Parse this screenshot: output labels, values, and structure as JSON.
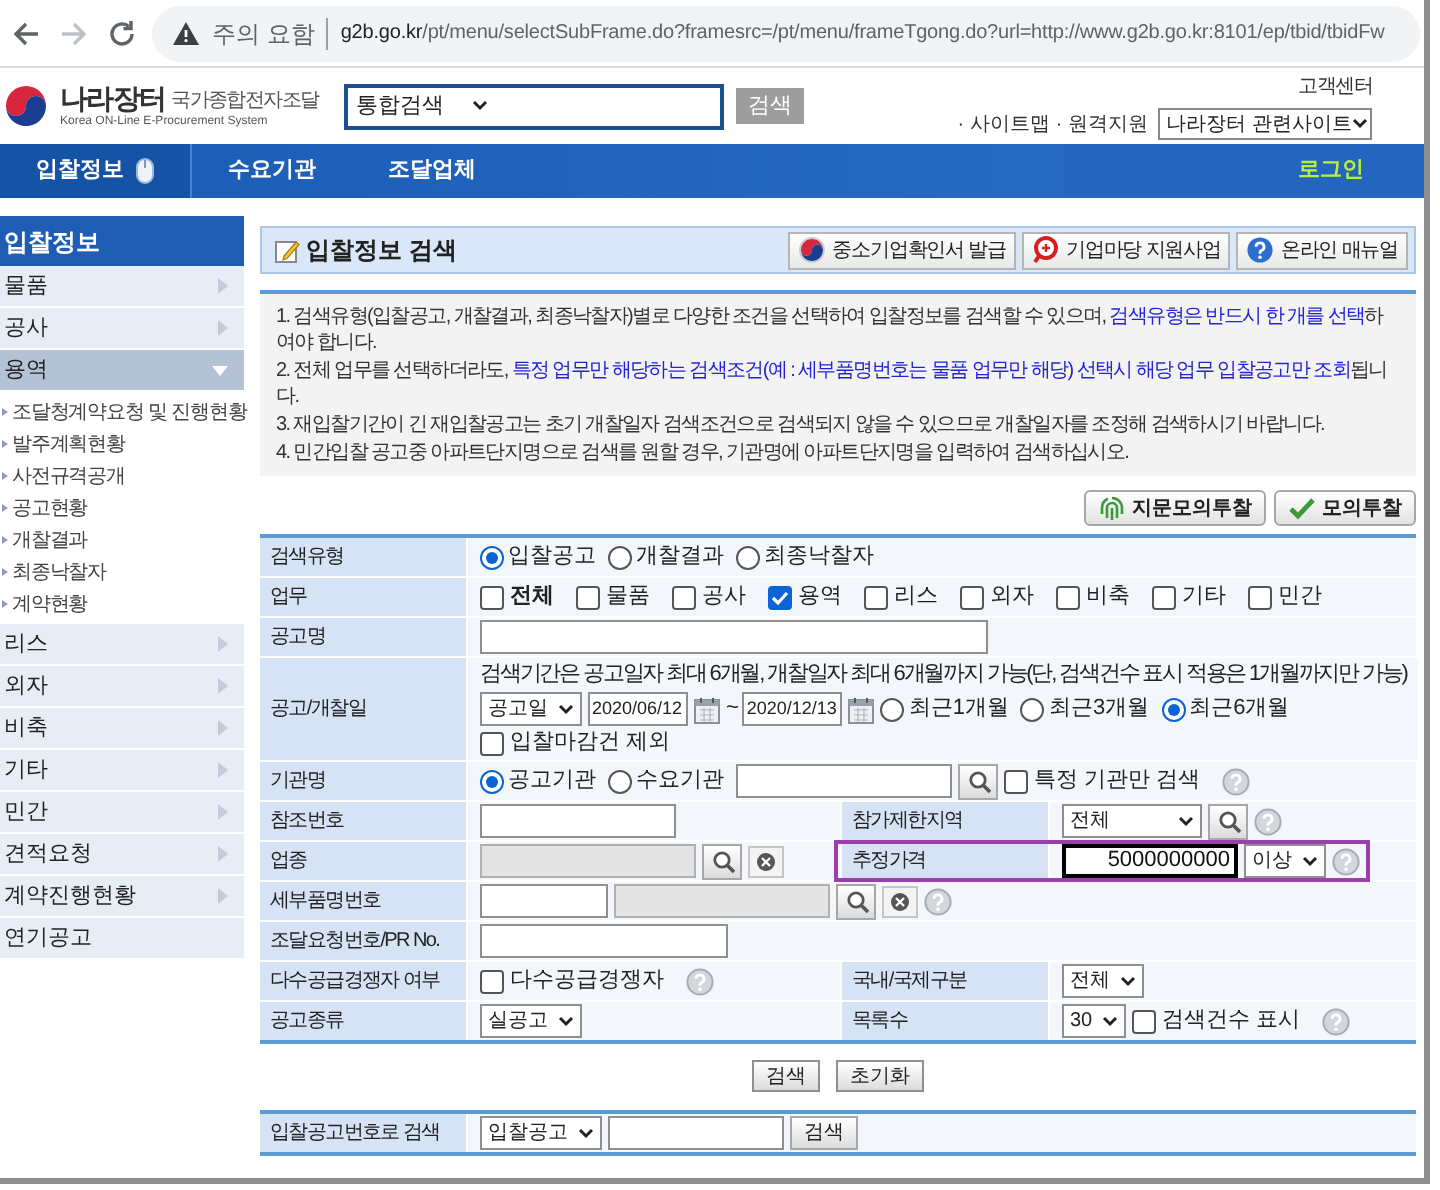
{
  "browser": {
    "warning": "주의 요함",
    "url_host": "g2b.go.kr",
    "url_path": "/pt/menu/selectSubFrame.do?framesrc=/pt/menu/frameTgong.do?url=http://www.g2b.go.kr:8101/ep/tbid/tbidFw"
  },
  "header": {
    "logo_title": "나라장터",
    "logo_subtitle": "국가종합전자조달",
    "logo_english": "Korea ON-Line E-Procurement System",
    "search_scope": "통합검색",
    "search_button": "검색",
    "customer_center": "고객센터",
    "links": [
      "· 사이트맵",
      "· 원격지원"
    ],
    "related_sites": "나라장터 관련사이트"
  },
  "nav": {
    "items": [
      {
        "label": "입찰정보",
        "selected": true
      },
      {
        "label": "수요기관",
        "selected": false
      },
      {
        "label": "조달업체",
        "selected": false
      }
    ],
    "login": "로그인"
  },
  "sidebar": {
    "title": "입찰정보",
    "items": [
      {
        "label": "물품",
        "kind": "group",
        "expanded": false
      },
      {
        "label": "공사",
        "kind": "group",
        "expanded": false
      },
      {
        "label": "용역",
        "kind": "group",
        "expanded": true,
        "children": [
          {
            "label": "조달청계약요청 및 진행현황"
          },
          {
            "label": "발주계획현황"
          },
          {
            "label": "사전규격공개"
          },
          {
            "label": "공고현황"
          },
          {
            "label": "개찰결과"
          },
          {
            "label": "최종낙찰자"
          },
          {
            "label": "계약현황"
          }
        ]
      },
      {
        "label": "리스",
        "kind": "group",
        "expanded": false
      },
      {
        "label": "외자",
        "kind": "group",
        "expanded": false
      },
      {
        "label": "비축",
        "kind": "group",
        "expanded": false
      },
      {
        "label": "기타",
        "kind": "group",
        "expanded": false
      },
      {
        "label": "민간",
        "kind": "group",
        "expanded": false
      },
      {
        "label": "견적요청",
        "kind": "group",
        "expanded": false
      },
      {
        "label": "계약진행현황",
        "kind": "group",
        "expanded": false
      },
      {
        "label": "연기공고",
        "kind": "link",
        "expanded": false
      }
    ]
  },
  "page": {
    "title": "입찰정보 검색",
    "buttons": [
      "중소기업확인서 발급",
      "기업마당 지원사업",
      "온라인 매뉴얼"
    ]
  },
  "notices": [
    [
      {
        "text": "1. 검색유형(입찰공고, 개찰결과, 최종낙찰자)별로 다양한 조건을 선택하여 입찰정보를 검색할 수 있으며, ",
        "highlight": false
      },
      {
        "text": "검색유형은 반드시 한 개를 선택",
        "highlight": true
      },
      {
        "text": "하여야 합니다.",
        "highlight": false
      }
    ],
    [
      {
        "text": "2. 전체 업무를 선택하더라도, ",
        "highlight": false
      },
      {
        "text": "특정 업무만 해당하는 검색조건(예 : 세부품명번호는 물품 업무만 해당) 선택시 해당 업무 입찰공고만 조회",
        "highlight": true
      },
      {
        "text": "됩니다.",
        "highlight": false
      }
    ],
    [
      {
        "text": "3. 재입찰기간이 긴 재입찰공고는 초기 개찰일자 검색조건으로 검색되지 않을 수 있으므로 개찰일자를 조정해 검색하시기 바랍니다.",
        "highlight": false
      }
    ],
    [
      {
        "text": "4. 민간입찰 공고중 아파트단지명으로 검색를 원할 경우, 기관명에 아파트단지명을 입력하여 검색하십시오.",
        "highlight": false
      }
    ]
  ],
  "actions": [
    "지문모의투찰",
    "모의투찰"
  ],
  "form": {
    "rows": [
      {
        "label": "검색유형",
        "lines": [
          [
            {
              "kind": "radio",
              "label": "입찰공고",
              "selected": true
            },
            {
              "kind": "radio",
              "label": "개찰결과",
              "selected": false
            },
            {
              "kind": "radio",
              "label": "최종낙찰자",
              "selected": false
            }
          ]
        ]
      },
      {
        "label": "업무",
        "lines": [
          [
            {
              "kind": "checkbox",
              "label": "전체",
              "checked": false,
              "bold": true
            },
            {
              "kind": "checkbox",
              "label": "물품",
              "checked": false,
              "bold": false
            },
            {
              "kind": "checkbox",
              "label": "공사",
              "checked": false,
              "bold": false
            },
            {
              "kind": "checkbox",
              "label": "용역",
              "checked": true,
              "bold": false
            },
            {
              "kind": "checkbox",
              "label": "리스",
              "checked": false,
              "bold": false
            },
            {
              "kind": "checkbox",
              "label": "외자",
              "checked": false,
              "bold": false
            },
            {
              "kind": "checkbox",
              "label": "비축",
              "checked": false,
              "bold": false
            },
            {
              "kind": "checkbox",
              "label": "기타",
              "checked": false,
              "bold": false
            },
            {
              "kind": "checkbox",
              "label": "민간",
              "checked": false,
              "bold": false
            }
          ]
        ]
      },
      {
        "label": "공고명",
        "lines": [
          [
            {
              "kind": "input",
              "disabled": false
            }
          ]
        ]
      },
      {
        "label": "공고/개찰일",
        "lines": [
          [
            {
              "kind": "text",
              "text": "검색기간은 공고일자 최대 6개월, 개찰일자 최대 6개월까지 가능(단, 검색건수 표시 적용은 1개월까지만 가능)"
            }
          ],
          [
            {
              "kind": "select",
              "value": "공고일"
            },
            {
              "kind": "date",
              "value": "2020/06/12"
            },
            {
              "kind": "calendar"
            },
            {
              "kind": "text",
              "text": "~"
            },
            {
              "kind": "date",
              "value": "2020/12/13"
            },
            {
              "kind": "calendar"
            },
            {
              "kind": "radio",
              "label": "최근1개월",
              "selected": false
            },
            {
              "kind": "radio",
              "label": "최근3개월",
              "selected": false
            },
            {
              "kind": "radio",
              "label": "최근6개월",
              "selected": true
            }
          ],
          [
            {
              "kind": "checkbox",
              "label": "입찰마감건 제외",
              "checked": false
            }
          ]
        ]
      },
      {
        "label": "기관명",
        "lines": [
          [
            {
              "kind": "radio",
              "label": "공고기관",
              "selected": true
            },
            {
              "kind": "radio",
              "label": "수요기관",
              "selected": false
            },
            {
              "kind": "input",
              "disabled": false
            },
            {
              "kind": "search"
            },
            {
              "kind": "checkbox",
              "label": "특정 기관만 검색",
              "checked": false
            },
            {
              "kind": "help"
            }
          ]
        ]
      },
      {
        "label": "참조번호",
        "lines": [
          [
            {
              "kind": "input",
              "disabled": false
            }
          ]
        ],
        "right": {
          "label": "참가제한지역",
          "highlighted": false,
          "lines": [
            [
              {
                "kind": "select",
                "value": "전체",
                "wide": true
              },
              {
                "kind": "search"
              },
              {
                "kind": "help"
              }
            ]
          ]
        }
      },
      {
        "label": "업종",
        "lines": [
          [
            {
              "kind": "input",
              "disabled": true
            },
            {
              "kind": "search"
            },
            {
              "kind": "clear"
            }
          ]
        ],
        "right": {
          "label": "추정가격",
          "highlighted": true,
          "lines": [
            [
              {
                "kind": "input",
                "disabled": false,
                "focused": true,
                "value": "5000000000"
              },
              {
                "kind": "select",
                "value": "이상"
              },
              {
                "kind": "help"
              }
            ]
          ]
        }
      },
      {
        "label": "세부품명번호",
        "lines": [
          [
            {
              "kind": "input",
              "disabled": false
            },
            {
              "kind": "input",
              "disabled": true
            },
            {
              "kind": "search"
            },
            {
              "kind": "clear"
            },
            {
              "kind": "help"
            }
          ]
        ]
      },
      {
        "label": "조달요청번호/PR No.",
        "lines": [
          [
            {
              "kind": "input",
              "disabled": false
            }
          ]
        ]
      },
      {
        "label": "다수공급경쟁자 여부",
        "lines": [
          [
            {
              "kind": "checkbox",
              "label": "다수공급경쟁자",
              "checked": false
            },
            {
              "kind": "help"
            }
          ]
        ],
        "right": {
          "label": "국내/국제구분",
          "highlighted": false,
          "lines": [
            [
              {
                "kind": "select",
                "value": "전체"
              }
            ]
          ]
        }
      },
      {
        "label": "공고종류",
        "lines": [
          [
            {
              "kind": "select",
              "value": "실공고"
            }
          ]
        ],
        "right": {
          "label": "목록수",
          "highlighted": false,
          "lines": [
            [
              {
                "kind": "select",
                "value": "30"
              },
              {
                "kind": "checkbox",
                "label": "검색건수 표시",
                "checked": false
              },
              {
                "kind": "help"
              }
            ]
          ]
        }
      }
    ],
    "buttons": [
      "검색",
      "초기화"
    ]
  },
  "number_search": {
    "label": "입찰공고번호로 검색",
    "lines": [
      [
        {
          "kind": "select",
          "value": "입찰공고"
        },
        {
          "kind": "input",
          "disabled": false
        },
        {
          "kind": "button",
          "label": "검색"
        }
      ]
    ]
  }
}
